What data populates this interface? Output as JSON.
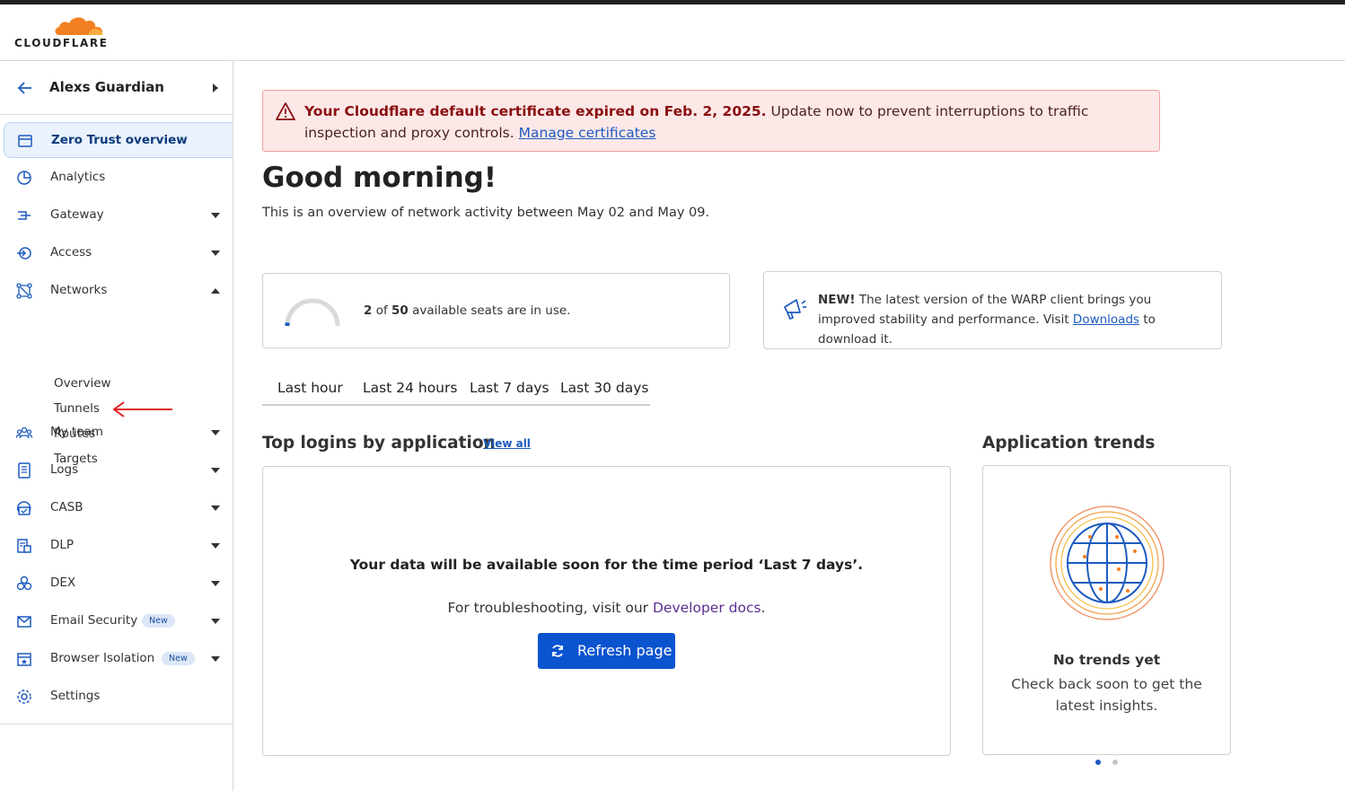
{
  "brand": {
    "name": "CLOUDFLARE",
    "accent": "#f38020"
  },
  "account": {
    "name": "Alexs Guardian"
  },
  "nav": {
    "items": [
      {
        "id": "overview",
        "label": "Zero Trust overview",
        "icon": "browser-window-icon",
        "caret": ""
      },
      {
        "id": "analytics",
        "label": "Analytics",
        "icon": "pie-chart-icon",
        "caret": ""
      },
      {
        "id": "gateway",
        "label": "Gateway",
        "icon": "gateway-icon",
        "caret": "down"
      },
      {
        "id": "access",
        "label": "Access",
        "icon": "access-icon",
        "caret": "down"
      },
      {
        "id": "networks",
        "label": "Networks",
        "icon": "network-icon",
        "caret": "up"
      },
      {
        "id": "myteam",
        "label": "My team",
        "icon": "team-icon",
        "caret": "down"
      },
      {
        "id": "logs",
        "label": "Logs",
        "icon": "logs-icon",
        "caret": "down"
      },
      {
        "id": "casb",
        "label": "CASB",
        "icon": "casb-icon",
        "caret": "down"
      },
      {
        "id": "dlp",
        "label": "DLP",
        "icon": "dlp-icon",
        "caret": "down"
      },
      {
        "id": "dex",
        "label": "DEX",
        "icon": "dex-icon",
        "caret": "down"
      },
      {
        "id": "email",
        "label": "Email Security",
        "icon": "email-security-icon",
        "caret": "down",
        "badge": "New"
      },
      {
        "id": "browser",
        "label": "Browser Isolation",
        "icon": "browser-isolation-icon",
        "caret": "down",
        "badge": "New"
      },
      {
        "id": "settings",
        "label": "Settings",
        "icon": "gear-icon",
        "caret": ""
      }
    ],
    "networks_sub": [
      "Overview",
      "Tunnels",
      "Routes",
      "Targets"
    ]
  },
  "alert": {
    "bold": "Your Cloudflare default certificate expired on Feb. 2, 2025.",
    "text": " Update now to prevent interruptions to traffic inspection and proxy controls. ",
    "link": "Manage certificates"
  },
  "greeting": "Good morning!",
  "overview_text": "This is an overview of network activity between May 02 and May 09.",
  "seats": {
    "used": "2",
    "of_text": " of ",
    "total": "50",
    "suffix": " available seats are in use.",
    "fraction": 0.04
  },
  "warp": {
    "new": "NEW!",
    "text": " The latest version of the WARP client brings you improved stability and performance. Visit ",
    "link": "Downloads",
    "suffix": " to download it."
  },
  "time_tabs": [
    "Last hour",
    "Last 24 hours",
    "Last 7 days",
    "Last 30 days"
  ],
  "logins": {
    "title": "Top logins by application",
    "view_all": "View all",
    "empty_msg": "Your data will be available soon for the time period ‘Last 7 days’.",
    "trouble_prefix": "For troubleshooting, visit our ",
    "trouble_link": "Developer docs",
    "trouble_suffix": ".",
    "refresh": "Refresh page"
  },
  "trends": {
    "title": "Application trends",
    "empty_title": "No trends yet",
    "empty_text": "Check back soon to get the latest insights."
  },
  "colors": {
    "primary": "#0b54d0",
    "alert_bg": "#fde8e8",
    "alert_text": "#8a0f0f"
  }
}
